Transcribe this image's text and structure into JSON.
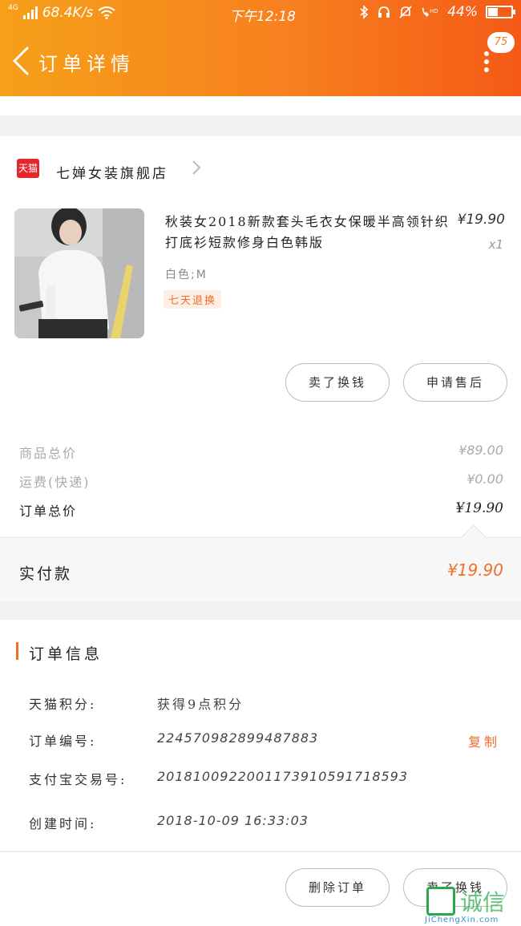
{
  "status_bar": {
    "network": "4G",
    "speed": "68.4K/s",
    "time": "下午12:18",
    "battery": "44%",
    "battery_level": 0.44
  },
  "header": {
    "title": "订单详情",
    "badge_count": "75"
  },
  "shop": {
    "platform_badge": "天猫",
    "name": "七婵女装旗舰店"
  },
  "product": {
    "name": "秋装女2018新款套头毛衣女保暖半高领针织打底衫短款修身白色韩版",
    "sku": "白色;M",
    "tag": "七天退换",
    "price": "¥19.90",
    "quantity": "x1",
    "buttons": [
      "卖了换钱",
      "申请售后"
    ]
  },
  "totals": {
    "goods_total_label": "商品总价",
    "goods_total_value": "¥89.00",
    "shipping_label": "运费(快递)",
    "shipping_value": "¥0.00",
    "order_total_label": "订单总价",
    "order_total_value": "¥19.90",
    "paid_label": "实付款",
    "paid_value": "¥19.90"
  },
  "order_info": {
    "title": "订单信息",
    "points_label": "天猫积分:",
    "points_value": "获得9点积分",
    "order_no_label": "订单编号:",
    "order_no_value": "224570982899487883",
    "copy_label": "复制",
    "alipay_label": "支付宝交易号:",
    "alipay_value": "2018100922001173910591718593",
    "created_label": "创建时间:",
    "created_value": "2018-10-09 16:33:03"
  },
  "footer": {
    "delete_button": "删除订单",
    "sell_button": "卖了换钱"
  },
  "watermark": {
    "text": "诚信",
    "site": "JiChengXin.com"
  },
  "colors": {
    "accent": "#f26d2b",
    "header_start": "#f6a019",
    "header_end": "#f55a16",
    "tmall_red": "#e4262b"
  }
}
